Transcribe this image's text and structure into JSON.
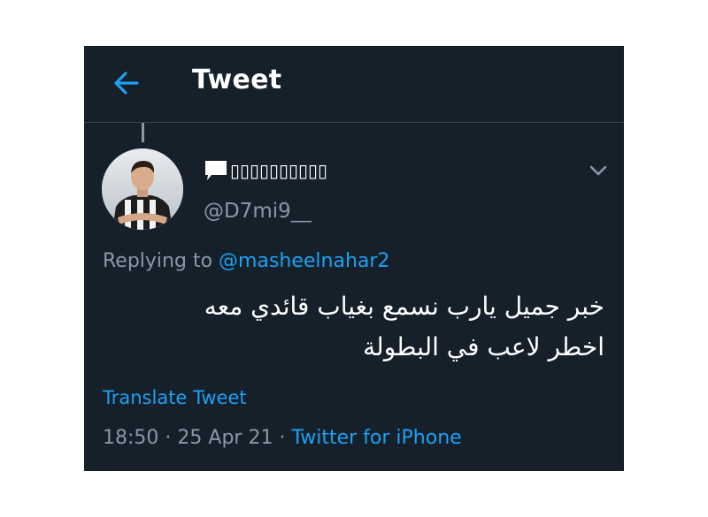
{
  "header": {
    "back_icon": "arrow-left-icon",
    "title": "Tweet"
  },
  "tweet": {
    "author": {
      "name_icon": "speech-bubble-icon",
      "display_name": "▯▯▯▯▯▯▯▯▯▯",
      "handle": "@D7mi9__",
      "avatar": "profile-photo"
    },
    "menu_icon": "chevron-down-icon",
    "replying_label": "Replying to",
    "replying_to": "@masheelnahar2",
    "text_lines": [
      "خبر جميل يارب نسمع بغياب قائدي معه",
      "اخطر لاعب في البطولة"
    ],
    "translate_label": "Translate Tweet",
    "time": "18:50",
    "date": "25 Apr 21",
    "separator": "·",
    "source": "Twitter for iPhone"
  },
  "colors": {
    "background": "#15202b",
    "accent": "#1da1f2",
    "secondary_text": "#8899a6",
    "primary_text": "#ffffff",
    "divider": "#38444d"
  }
}
